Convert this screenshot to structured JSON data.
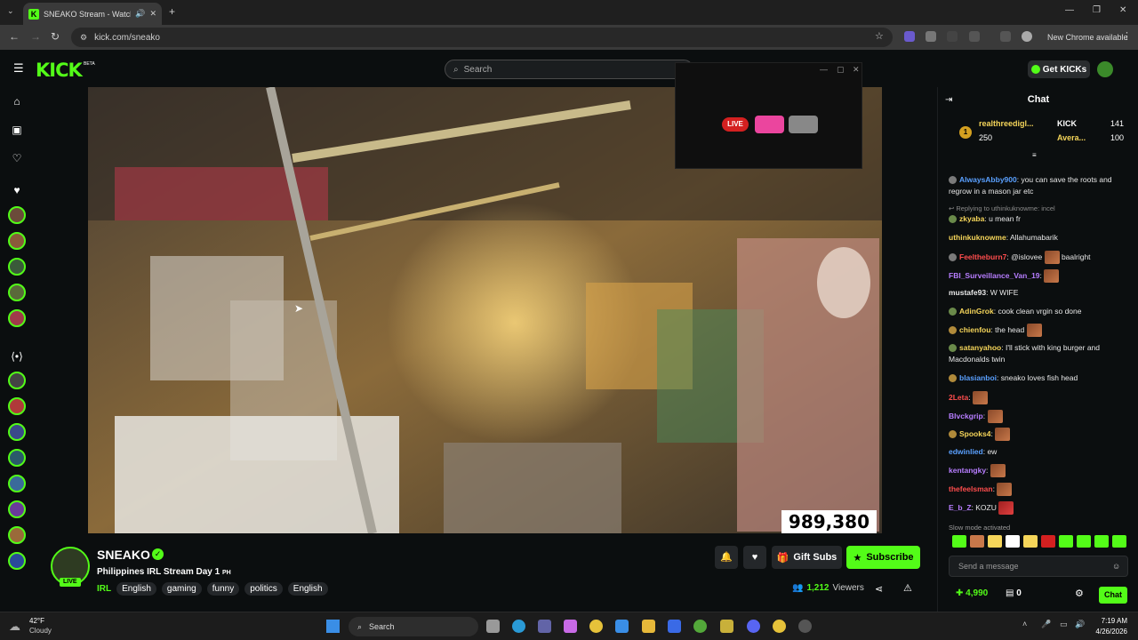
{
  "browser": {
    "tab_title": "SNEAKO Stream - Watch Li...",
    "url": "kick.com/sneako",
    "new_chrome": "New Chrome available"
  },
  "header": {
    "logo": "KICK",
    "beta": "BETA",
    "search_placeholder": "Search",
    "get_kicks": "Get KICKs"
  },
  "video": {
    "viewer_overlay": "989,380"
  },
  "discord_overlay": {
    "live_label": "LIVE"
  },
  "stream": {
    "streamer": "SNEAKO",
    "live": "LIVE",
    "title": "Philippines IRL Stream Day 1",
    "title_suffix": "PH",
    "category": "IRL",
    "tags": [
      "English",
      "gaming",
      "funny",
      "politics",
      "English"
    ],
    "gift_subs": "Gift Subs",
    "subscribe": "Subscribe",
    "viewers_count": "1,212",
    "viewers_label": "Viewers"
  },
  "chat": {
    "title": "Chat",
    "leaderboard": [
      {
        "rank": "1",
        "name": "realthreedigl...",
        "points": "250"
      },
      {
        "name": "KICK",
        "points": "141"
      },
      {
        "name": "Avera...",
        "points": "100"
      }
    ],
    "messages": [
      {
        "user": "AlwaysAbby900",
        "color": "#5aa0ff",
        "text": ": you can save the roots and regrow in a mason jar etc"
      },
      {
        "reply": "Replying to uthinkuknowme: incel"
      },
      {
        "user": "zkyaba",
        "color": "#f5d55a",
        "text": ": u mean fr"
      },
      {
        "user": "uthinkuknowme",
        "color": "#f5d55a",
        "text": ": Allahumabarik"
      },
      {
        "user": "Feeltheburn7",
        "color": "#ff4d4d",
        "text": ": @islovee",
        "text2": "baalright"
      },
      {
        "user": "FBI_Surveillance_Van_19",
        "color": "#b77dff",
        "text": ":"
      },
      {
        "user": "mustafe93",
        "color": "#e8e8e8",
        "text": ": W WIFE"
      },
      {
        "user": "AdinGrok",
        "color": "#f5d55a",
        "text": ": cook clean vrgin so done"
      },
      {
        "user": "chienfou",
        "color": "#f5d55a",
        "text": ": the head"
      },
      {
        "user": "satanyahoo",
        "color": "#f5d55a",
        "text": ": I'll stick with king burger and Macdonalds twin"
      },
      {
        "user": "blasianboi",
        "color": "#5aa0ff",
        "text": ": sneako loves fish head"
      },
      {
        "user": "2Leta",
        "color": "#ff4d4d",
        "text": ":"
      },
      {
        "user": "Blvckgrip",
        "color": "#b77dff",
        "text": ":"
      },
      {
        "user": "Spooks4",
        "color": "#f5d55a",
        "text": ":"
      },
      {
        "user": "edwinlied",
        "color": "#5aa0ff",
        "text": ": ew"
      },
      {
        "user": "kentangky",
        "color": "#b77dff",
        "text": ":"
      },
      {
        "user": "thefeelsman",
        "color": "#ff4d4d",
        "text": ":"
      },
      {
        "user": "E_b_Z",
        "color": "#b77dff",
        "text": ": KOZU"
      }
    ],
    "slow_mode": "Slow mode activated",
    "input_placeholder": "Send a message",
    "kicks_balance": "4,990",
    "gift_count": "0",
    "send_label": "Chat"
  },
  "taskbar": {
    "temp": "42°F",
    "weather": "Cloudy",
    "search": "Search",
    "time": "7:19 AM",
    "date": "4/26/2026"
  },
  "colors": {
    "accent": "#53fc18",
    "background": "#0b0e0f"
  }
}
